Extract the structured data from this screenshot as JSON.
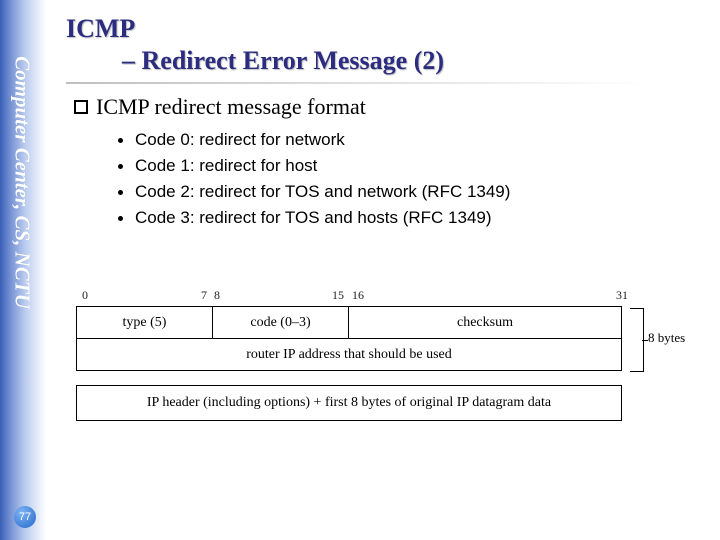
{
  "sidebar": {
    "label": "Computer Center, CS, NCTU",
    "page_number": "77"
  },
  "title": {
    "line1": "ICMP",
    "line2": "– Redirect Error Message (2)"
  },
  "section_heading": "ICMP redirect message format",
  "bullets": [
    "Code 0: redirect for network",
    "Code 1: redirect for host",
    "Code 2: redirect for TOS and network (RFC 1349)",
    "Code 3: redirect for TOS and hosts (RFC 1349)"
  ],
  "diagram": {
    "bit_labels": {
      "b0": "0",
      "b7": "7",
      "b8": "8",
      "b15": "15",
      "b16": "16",
      "b31": "31"
    },
    "fields": {
      "type": "type (5)",
      "code": "code (0–3)",
      "checksum": "checksum",
      "router_ip": "router IP address that should be used",
      "payload": "IP header (including options) + first 8 bytes of original IP datagram data"
    },
    "brace_label": "8 bytes"
  }
}
